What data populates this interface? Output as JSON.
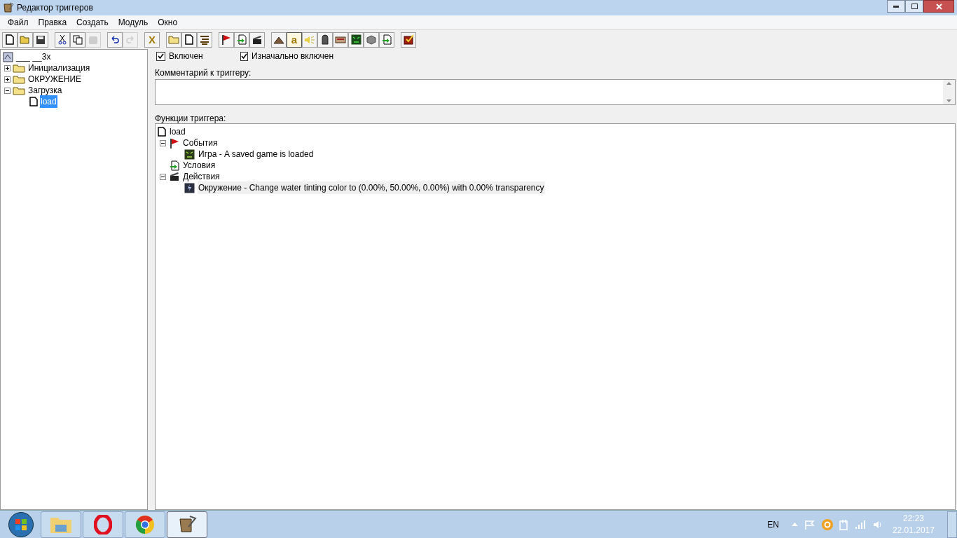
{
  "window": {
    "title": "Редактор триггеров"
  },
  "menu": [
    "Файл",
    "Правка",
    "Создать",
    "Модуль",
    "Окно"
  ],
  "toolbar": [
    [
      {
        "kind": "new",
        "disabled": false,
        "pressed": false
      },
      {
        "kind": "open",
        "disabled": false,
        "pressed": false
      },
      {
        "kind": "save",
        "disabled": false,
        "pressed": false
      }
    ],
    [
      {
        "kind": "cut",
        "disabled": false,
        "pressed": false
      },
      {
        "kind": "copy",
        "disabled": false,
        "pressed": false
      },
      {
        "kind": "paste",
        "disabled": true,
        "pressed": false
      }
    ],
    [
      {
        "kind": "undo",
        "disabled": false,
        "pressed": false
      },
      {
        "kind": "redo",
        "disabled": true,
        "pressed": false
      }
    ],
    [
      {
        "kind": "letter",
        "label": "X",
        "disabled": false,
        "pressed": false
      }
    ],
    [
      {
        "kind": "folder",
        "disabled": false,
        "pressed": false
      },
      {
        "kind": "new",
        "disabled": false,
        "pressed": false
      },
      {
        "kind": "lines",
        "disabled": false,
        "pressed": false
      }
    ],
    [
      {
        "kind": "flag",
        "disabled": false,
        "pressed": false
      },
      {
        "kind": "condition",
        "disabled": false,
        "pressed": false
      },
      {
        "kind": "clapper",
        "disabled": false,
        "pressed": false
      }
    ],
    [
      {
        "kind": "terrain",
        "disabled": false,
        "pressed": false
      },
      {
        "kind": "letter",
        "label": "a",
        "disabled": false,
        "pressed": true
      },
      {
        "kind": "speaker",
        "disabled": false,
        "pressed": false
      },
      {
        "kind": "statue",
        "disabled": false,
        "pressed": false
      },
      {
        "kind": "panel",
        "disabled": false,
        "pressed": false
      },
      {
        "kind": "monster",
        "disabled": false,
        "pressed": false
      },
      {
        "kind": "cube",
        "disabled": false,
        "pressed": false
      },
      {
        "kind": "condition",
        "disabled": false,
        "pressed": false
      }
    ],
    [
      {
        "kind": "check",
        "disabled": false,
        "pressed": false
      }
    ]
  ],
  "trigger_tree": {
    "label": "___ __3x",
    "children": [
      {
        "label": "Инициализация",
        "expanded": false,
        "selected": false,
        "kind": "folder"
      },
      {
        "label": "ОКРУЖЕНИЕ",
        "expanded": false,
        "selected": false,
        "kind": "folder"
      },
      {
        "label": "Загрузка",
        "expanded": true,
        "selected": false,
        "kind": "folder",
        "children": [
          {
            "label": "load",
            "selected": true,
            "kind": "trigger"
          }
        ]
      }
    ]
  },
  "options": [
    {
      "label": "Включен",
      "checked": true
    },
    {
      "label": "Изначально включен",
      "checked": true
    }
  ],
  "comment": {
    "label": "Комментарий к триггеру:"
  },
  "functions": {
    "label": "Функции триггера:",
    "root": "load",
    "groups": [
      {
        "label": "События",
        "kind": "events",
        "expanded": true,
        "children": [
          {
            "label": "Игра - A saved game is loaded",
            "kind": "game",
            "selected": false
          }
        ]
      },
      {
        "label": "Условия",
        "kind": "conditions"
      },
      {
        "label": "Действия",
        "kind": "actions",
        "expanded": true,
        "children": [
          {
            "label": "Окружение - Change water tinting color to (0.00%, 50.00%, 0.00%) with 0.00% transparency",
            "kind": "storm",
            "selected": true
          }
        ]
      }
    ]
  },
  "taskbar": {
    "apps": [
      {
        "kind": "explorer",
        "active": false
      },
      {
        "kind": "opera",
        "active": false
      },
      {
        "kind": "chrome",
        "active": false
      },
      {
        "kind": "scroll",
        "active": true
      }
    ],
    "language": "EN",
    "time": "22:23",
    "date": "22.01.2017"
  }
}
